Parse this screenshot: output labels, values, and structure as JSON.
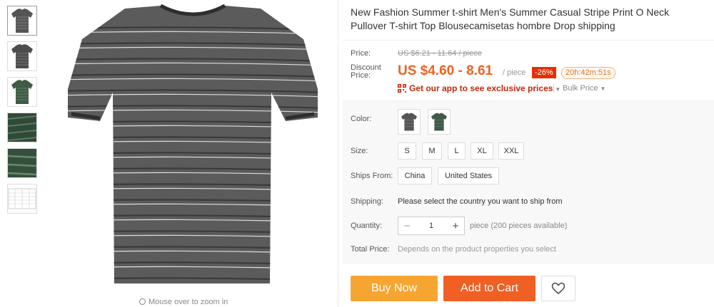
{
  "product": {
    "title": "New Fashion Summer t-shirt Men's Summer Casual Stripe Print O Neck Pullover T-shirt Top Blousecamisetas hombre Drop shipping",
    "zoom_hint": "Mouse over to zoom in"
  },
  "thumbnails": [
    {
      "label": "gray-tshirt-front"
    },
    {
      "label": "gray-tshirt-back"
    },
    {
      "label": "green-tshirt-front"
    },
    {
      "label": "green-fabric-detail"
    },
    {
      "label": "green-fabric-closeup"
    },
    {
      "label": "size-chart"
    }
  ],
  "price": {
    "label": "Price:",
    "original": "US $6.21 - 11.64 / piece",
    "discount_label": "Discount Price:",
    "discount": "US $4.60 - 8.61",
    "unit": "/ piece",
    "discount_badge": "-26%",
    "timer": "20h:42m:51s",
    "app_promo": "Get our app to see exclusive prices",
    "bulk": "Bulk Price"
  },
  "options": {
    "color_label": "Color:",
    "colors": [
      {
        "name": "gray",
        "hex": "#5a5a5a"
      },
      {
        "name": "green",
        "hex": "#3f5a45"
      }
    ],
    "size_label": "Size:",
    "sizes": [
      "S",
      "M",
      "L",
      "XL",
      "XXL"
    ],
    "ships_from_label": "Ships From:",
    "ships_from": [
      "China",
      "United States"
    ],
    "shipping_label": "Shipping:",
    "shipping_text": "Please select the country you want to ship from",
    "quantity_label": "Quantity:",
    "quantity_value": "1",
    "quantity_note": "piece (200 pieces available)",
    "total_label": "Total Price:",
    "total_text": "Depends on the product properties you select"
  },
  "actions": {
    "buy_now": "Buy Now",
    "add_to_cart": "Add to Cart"
  },
  "colors": {
    "accent": "#f16122",
    "buy_now_bg": "#f7a531",
    "cart_bg": "#f05f23",
    "badge_bg": "#e62e04"
  }
}
